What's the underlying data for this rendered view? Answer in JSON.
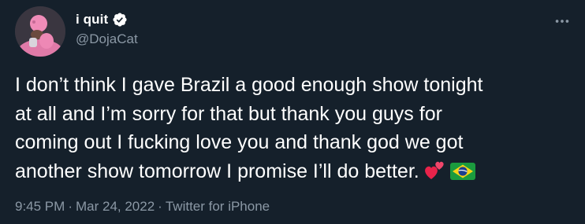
{
  "author": {
    "display_name": "i quit",
    "handle": "@DojaCat",
    "verified_icon": "verified-badge-icon"
  },
  "tweet": {
    "text": "I don’t think I gave Brazil a good enough show tonight\nat all and I’m sorry for that but thank you guys for\ncoming out I fucking love you and thank god we got\nanother show tomorrow I promise I’ll do better.",
    "emojis": [
      "two-hearts-emoji",
      "brazil-flag-emoji"
    ]
  },
  "meta": {
    "time": "9:45 PM",
    "separator": "·",
    "date": "Mar 24, 2022",
    "source": "Twitter for iPhone"
  },
  "colors": {
    "background": "#15202b",
    "text": "#ffffff",
    "secondary": "#8b98a5",
    "verified": "#ffffff"
  },
  "icons": {
    "more": "more-horizontal-icon"
  }
}
